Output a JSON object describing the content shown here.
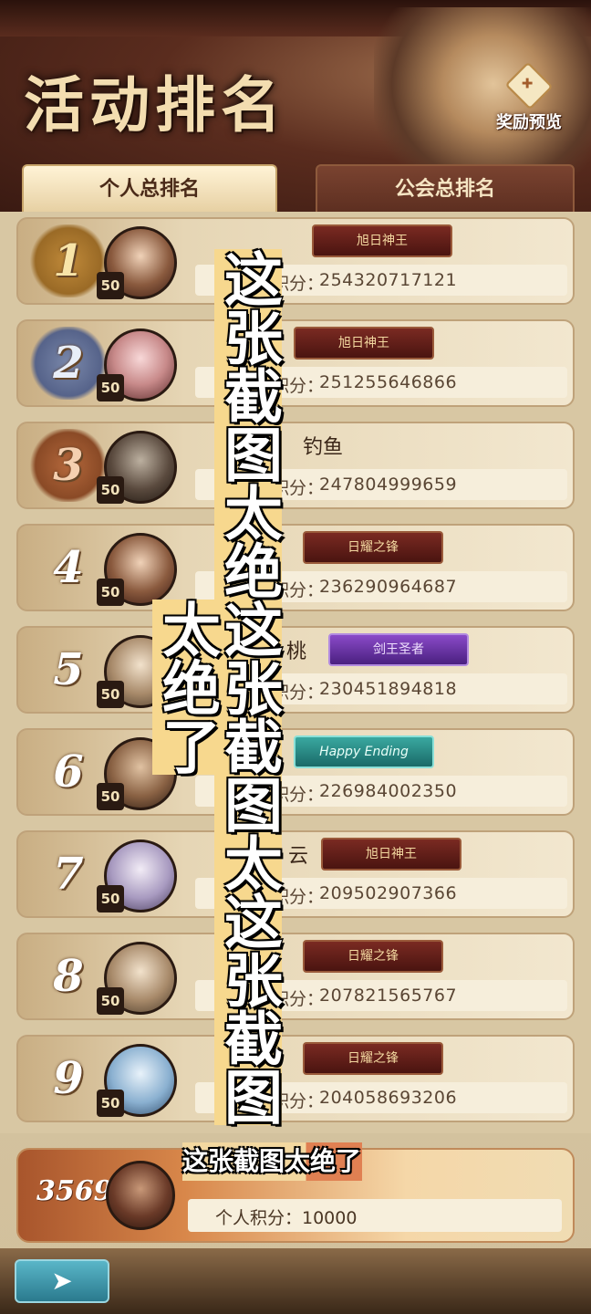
{
  "header": {
    "title": "活动排名",
    "reward_label": "奖励预览"
  },
  "tabs": [
    {
      "label": "个人总排名",
      "active": true
    },
    {
      "label": "公会总排名",
      "active": false
    }
  ],
  "score_prefix": "个人积分：",
  "level": "50",
  "rows": [
    {
      "rank": "1",
      "name": "",
      "badge": "旭日神王",
      "badge_style": "red",
      "score": "254320717121"
    },
    {
      "rank": "2",
      "name": "",
      "badge": "旭日神王",
      "badge_style": "red",
      "score": "251255646866"
    },
    {
      "rank": "3",
      "name": "钓鱼",
      "badge": "",
      "badge_style": "",
      "score": "247804999659"
    },
    {
      "rank": "4",
      "name": "",
      "badge": "日耀之锋",
      "badge_style": "red",
      "score": "236290964687"
    },
    {
      "rank": "5",
      "name": "桃",
      "badge": "剑王圣者",
      "badge_style": "purple",
      "score": "230451894818"
    },
    {
      "rank": "6",
      "name": "",
      "badge": "Happy Ending",
      "badge_style": "teal",
      "score": "226984002350"
    },
    {
      "rank": "7",
      "name": "云",
      "badge": "旭日神王",
      "badge_style": "red",
      "score": "209502907366"
    },
    {
      "rank": "8",
      "name": "",
      "badge": "日耀之锋",
      "badge_style": "red",
      "score": "207821565767"
    },
    {
      "rank": "9",
      "name": "",
      "badge": "日耀之锋",
      "badge_style": "red",
      "score": "204058693206"
    }
  ],
  "me": {
    "rank": "3569",
    "score": "个人积分：10000"
  },
  "overlay": {
    "vertical": "这张截图太绝这张截图太这张截图太绝了",
    "horizontal": "这张截图太绝了"
  },
  "colors": {
    "accent_gold": "#f3ddb0",
    "header_bg": "#5a2c1e",
    "overlay_yellow": "#f7d88e",
    "overlay_orange": "#e08052"
  }
}
